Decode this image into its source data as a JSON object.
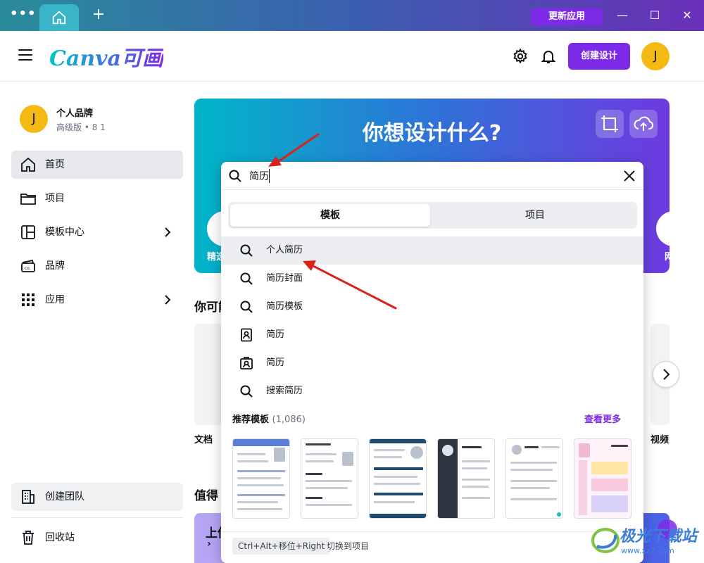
{
  "titlebar": {
    "update_label": "更新应用",
    "win_minimize": "—",
    "win_maximize": "☐",
    "win_close": "✕",
    "plus": "+"
  },
  "header": {
    "logo_text": "Canva可画",
    "create_label": "创建设计",
    "avatar_initial": "J"
  },
  "sidebar": {
    "profile": {
      "initial": "J",
      "name": "个人品牌",
      "sub": "高级版 • 8 1"
    },
    "items": [
      {
        "label": "首页",
        "icon": "home-icon",
        "active": true,
        "chevron": false
      },
      {
        "label": "项目",
        "icon": "folder-icon",
        "active": false,
        "chevron": false
      },
      {
        "label": "模板中心",
        "icon": "template-icon",
        "active": false,
        "chevron": true
      },
      {
        "label": "品牌",
        "icon": "brand-icon",
        "active": false,
        "chevron": false
      },
      {
        "label": "应用",
        "icon": "apps-grid-icon",
        "active": false,
        "chevron": true
      }
    ],
    "team_label": "创建团队",
    "trash_label": "回收站"
  },
  "main": {
    "banner_title": "你想设计什么?",
    "banner_left_label": "精选",
    "banner_right_label": "网",
    "section1_title": "你可能",
    "card_left_label": "文档",
    "card_right_label": "视频",
    "section2_title": "值得",
    "bottom_label": "上传"
  },
  "search": {
    "query": "简历",
    "tabs": [
      {
        "label": "模板",
        "active": true
      },
      {
        "label": "项目",
        "active": false
      }
    ],
    "suggestions": [
      {
        "label": "个人简历",
        "icon": "search-icon",
        "hover": true
      },
      {
        "label": "简历封面",
        "icon": "search-icon",
        "hover": false
      },
      {
        "label": "简历模板",
        "icon": "search-icon",
        "hover": false
      },
      {
        "label": "简历",
        "icon": "resume-doc-icon",
        "hover": false
      },
      {
        "label": "简历",
        "icon": "resume-id-icon",
        "hover": false
      },
      {
        "label": "搜索简历",
        "icon": "search-icon",
        "hover": false
      }
    ],
    "recommended_title": "推荐模板",
    "recommended_count": "(1,086)",
    "see_more": "查看更多",
    "shortcut": "Ctrl+Alt+移位+Right",
    "shortcut_action": "切换到项目"
  },
  "watermark": {
    "text": "极光下载站",
    "url": "www.xz7.com"
  },
  "colors": {
    "accent": "#7d2ae8",
    "teal": "#00c4cc",
    "avatar": "#f5b914",
    "arrow": "#d9221c"
  }
}
